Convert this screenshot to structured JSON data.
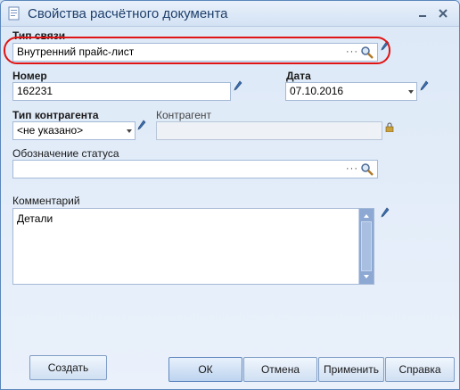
{
  "window": {
    "title": "Свойства расчётного документа"
  },
  "fields": {
    "link_type": {
      "label": "Тип связи",
      "value": "Внутренний прайс-лист"
    },
    "number": {
      "label": "Номер",
      "value": "162231"
    },
    "date": {
      "label": "Дата",
      "value": "07.10.2016"
    },
    "counterparty_type": {
      "label": "Тип контрагента",
      "value": "<не указано>"
    },
    "counterparty": {
      "label": "Контрагент",
      "value": ""
    },
    "status_designation": {
      "label": "Обозначение статуса",
      "value": ""
    },
    "comment": {
      "label": "Комментарий",
      "value": "Детали"
    }
  },
  "buttons": {
    "create": "Создать",
    "ok": "ОК",
    "cancel": "Отмена",
    "apply": "Применить",
    "help": "Справка"
  },
  "colors": {
    "highlight": "#e01414",
    "accent": "#1e3f6b",
    "scrollbar": "#8ca8d3"
  },
  "icons": [
    "app-icon",
    "search-icon",
    "pencil-icon",
    "lock-icon",
    "dropdown-arrow-icon",
    "minimize-icon",
    "close-icon"
  ]
}
